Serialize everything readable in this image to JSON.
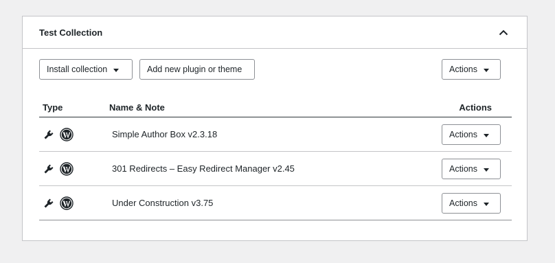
{
  "panel": {
    "title": "Test Collection",
    "collapse_icon": "chevron-up-icon"
  },
  "toolbar": {
    "install_label": "Install collection",
    "add_label": "Add new plugin or theme",
    "actions_label": "Actions"
  },
  "table": {
    "headers": {
      "type": "Type",
      "name": "Name & Note",
      "actions": "Actions"
    },
    "rows": [
      {
        "name": "Simple Author Box v2.3.18",
        "type_icons": [
          "plugin-icon",
          "wordpress-icon"
        ],
        "actions_label": "Actions"
      },
      {
        "name": "301 Redirects – Easy Redirect Manager v2.45",
        "type_icons": [
          "plugin-icon",
          "wordpress-icon"
        ],
        "actions_label": "Actions"
      },
      {
        "name": "Under Construction v3.75",
        "type_icons": [
          "plugin-icon",
          "wordpress-icon"
        ],
        "actions_label": "Actions"
      }
    ]
  }
}
